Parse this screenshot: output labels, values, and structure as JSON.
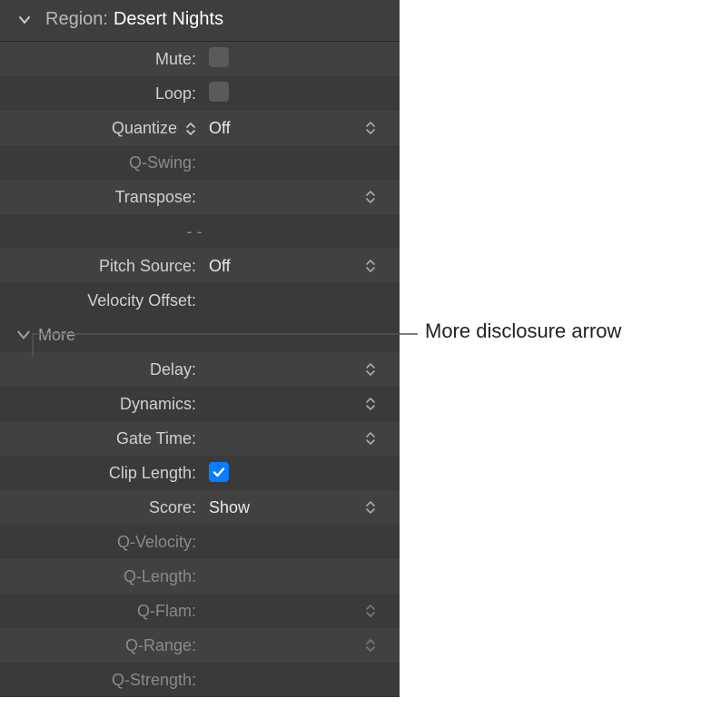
{
  "header": {
    "label": "Region:",
    "value": "Desert Nights"
  },
  "rows": {
    "mute": {
      "label": "Mute:"
    },
    "loop": {
      "label": "Loop:"
    },
    "quantize": {
      "label": "Quantize",
      "value": "Off"
    },
    "qswing": {
      "label": "Q-Swing:"
    },
    "transpose": {
      "label": "Transpose:"
    },
    "dashes": {
      "value": "-   -"
    },
    "pitchsource": {
      "label": "Pitch Source:",
      "value": "Off"
    },
    "velocityoffset": {
      "label": "Velocity Offset:"
    },
    "more": {
      "label": "More"
    },
    "delay": {
      "label": "Delay:"
    },
    "dynamics": {
      "label": "Dynamics:"
    },
    "gatetime": {
      "label": "Gate Time:"
    },
    "cliplength": {
      "label": "Clip Length:"
    },
    "score": {
      "label": "Score:",
      "value": "Show"
    },
    "qvelocity": {
      "label": "Q-Velocity:"
    },
    "qlength": {
      "label": "Q-Length:"
    },
    "qflam": {
      "label": "Q-Flam:"
    },
    "qrange": {
      "label": "Q-Range:"
    },
    "qstrength": {
      "label": "Q-Strength:"
    }
  },
  "callout": {
    "text": "More disclosure arrow"
  }
}
